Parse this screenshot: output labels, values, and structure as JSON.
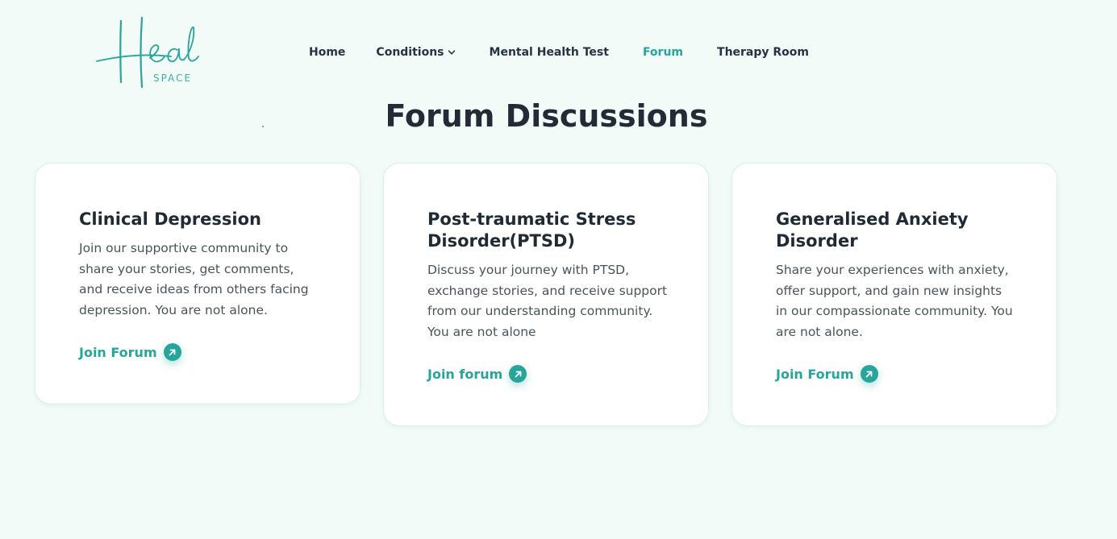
{
  "logo": {
    "word": "Heal",
    "sub": "SPACE"
  },
  "nav": {
    "items": [
      {
        "label": "Home"
      },
      {
        "label": "Conditions"
      },
      {
        "label": "Mental Health Test"
      },
      {
        "label": "Forum"
      },
      {
        "label": "Therapy Room"
      }
    ],
    "active": "Forum",
    "conditions_icon": "chevron-down-icon"
  },
  "page": {
    "title": "Forum Discussions"
  },
  "cards": [
    {
      "title": "Clinical Depression",
      "text": "Join our supportive community to share your stories, get comments, and receive ideas from others facing depression. You are not alone.",
      "link": "Join Forum",
      "icon": "arrow-up-right-icon"
    },
    {
      "title": "Post-traumatic Stress Disorder(PTSD)",
      "text": "Discuss your journey with PTSD, exchange stories, and receive support from our understanding community. You are not alone",
      "link": "Join forum",
      "icon": "arrow-up-right-icon"
    },
    {
      "title": "Generalised Anxiety Disorder",
      "text": "Share your experiences with anxiety, offer support, and gain new insights in our compassionate community. You are not alone.",
      "link": "Join Forum",
      "icon": "arrow-up-right-icon"
    }
  ],
  "colors": {
    "accent": "#26a59a",
    "background": "#f2fbf8",
    "heading": "#1f2a35",
    "body_text": "#4a535c"
  }
}
